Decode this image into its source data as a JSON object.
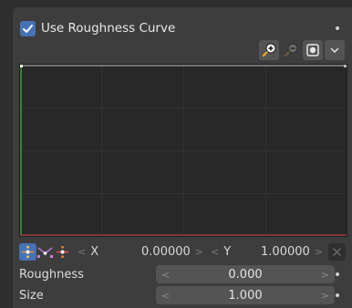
{
  "header": {
    "checkbox_label": "Use Roughness Curve",
    "checked": true
  },
  "curve_toolbar": {
    "icons": [
      "zoom-in-icon",
      "zoom-out-icon",
      "clipping-icon",
      "dropdown-chevron-icon"
    ]
  },
  "curve_controls": {
    "icons": [
      "handle-auto-icon",
      "handle-vector-icon",
      "handle-auto-clamped-icon"
    ],
    "x_label": "X",
    "x_value": "0.00000",
    "y_label": "Y",
    "y_value": "1.00000"
  },
  "properties": [
    {
      "label": "Roughness",
      "value": "0.000"
    },
    {
      "label": "Size",
      "value": "1.000"
    }
  ],
  "colors": {
    "accent": "#4772b3",
    "panel": "#3d3d3d",
    "curve_bg": "#282828"
  }
}
